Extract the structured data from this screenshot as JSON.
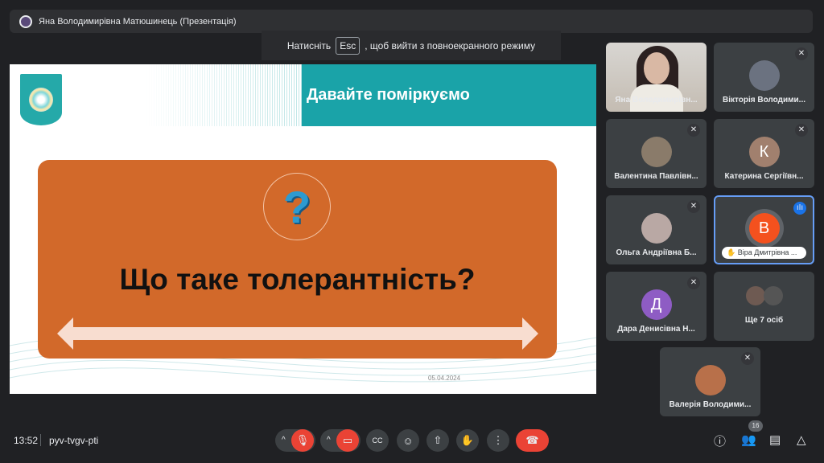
{
  "topbar": {
    "presenter": "Яна Володимирівна Матюшинець (Презентація)"
  },
  "toast": {
    "before": "Натисніть",
    "key": "Esc",
    "after": ", щоб вийти з повноекранного режиму"
  },
  "slide": {
    "title": "Давайте поміркуємо",
    "question": "Що таке толерантність?",
    "date": "05.04.2024",
    "colors": {
      "teal": "#1aa3a8",
      "orange": "#d2692a"
    }
  },
  "tiles": [
    {
      "name": "Яна Володимирівн...",
      "type": "video"
    },
    {
      "name": "Вікторія Володими...",
      "muted": true
    },
    {
      "name": "Валентина Павлівн...",
      "muted": true
    },
    {
      "name": "Катерина Сергіївн...",
      "initial": "К",
      "color": "#a1806e",
      "muted": true
    },
    {
      "name": "Ольга Андріївна Б...",
      "muted": true
    },
    {
      "name": "Віра Дмитрівна ...",
      "initial": "В",
      "color": "#f4511e",
      "speaking": true,
      "hand_raised": true
    },
    {
      "name": "Дара Денисівна Н...",
      "initial": "Д",
      "color": "#8e5cc4",
      "muted": true
    },
    {
      "name": "Ще 7 осіб"
    },
    {
      "name": "Валерія Володими...",
      "muted": true
    }
  ],
  "bottom": {
    "time": "13:52",
    "meeting_code": "pyv-tvgv-pti",
    "participant_count": "16"
  }
}
